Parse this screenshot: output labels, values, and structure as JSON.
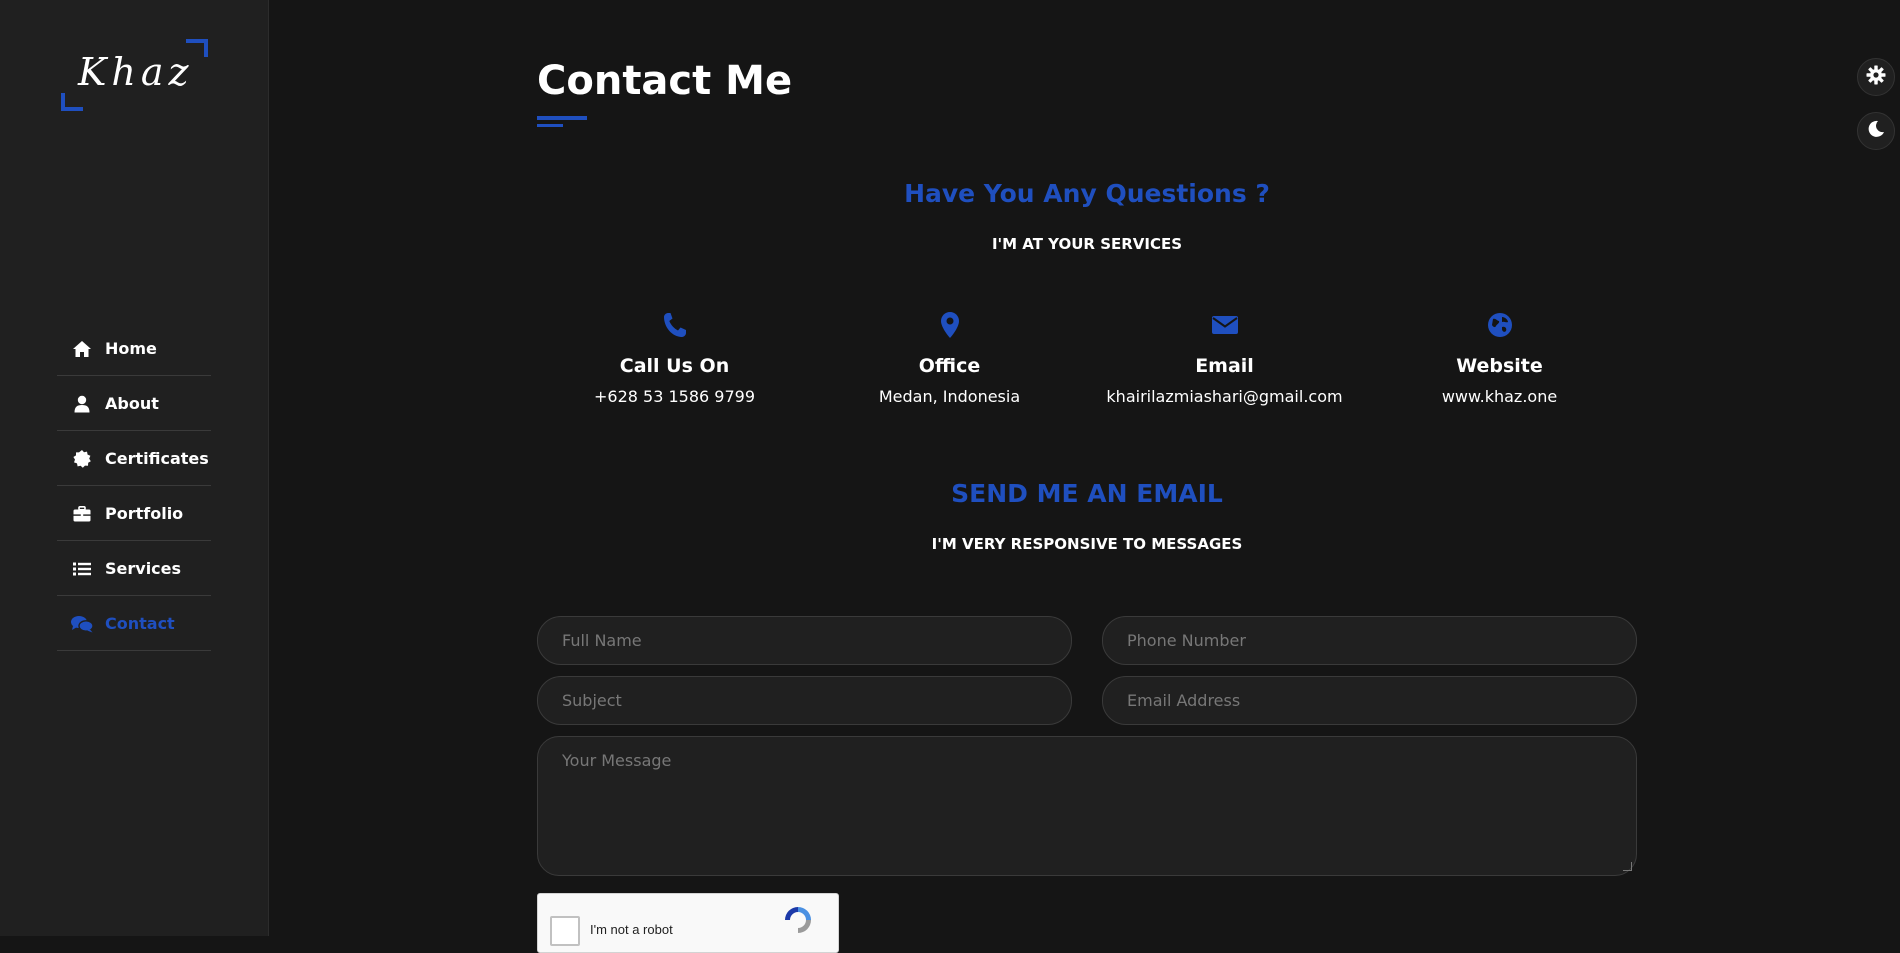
{
  "brand": {
    "logo_text": "Khaz"
  },
  "sidebar": {
    "items": [
      {
        "label": "Home",
        "icon": "home-icon"
      },
      {
        "label": "About",
        "icon": "user-icon"
      },
      {
        "label": "Certificates",
        "icon": "certificate-icon"
      },
      {
        "label": "Portfolio",
        "icon": "briefcase-icon"
      },
      {
        "label": "Services",
        "icon": "list-icon"
      },
      {
        "label": "Contact",
        "icon": "comments-icon",
        "active": true
      }
    ]
  },
  "main": {
    "page_title": "Contact Me",
    "questions_heading": "Have You Any Questions ?",
    "questions_sub": "I'M AT YOUR SERVICES",
    "info": [
      {
        "title": "Call Us On",
        "value": "+628 53 1586 9799",
        "icon": "phone-icon"
      },
      {
        "title": "Office",
        "value": "Medan, Indonesia",
        "icon": "map-marker-icon"
      },
      {
        "title": "Email",
        "value": "khairilazmiashari@gmail.com",
        "icon": "envelope-icon"
      },
      {
        "title": "Website",
        "value": "www.khaz.one",
        "icon": "globe-icon"
      }
    ],
    "email_heading": "SEND ME AN EMAIL",
    "email_sub": "I'M VERY RESPONSIVE TO MESSAGES",
    "form": {
      "full_name_placeholder": "Full Name",
      "phone_placeholder": "Phone Number",
      "subject_placeholder": "Subject",
      "email_placeholder": "Email Address",
      "message_placeholder": "Your Message"
    },
    "captcha_label": "I'm not a robot"
  },
  "theme": {
    "accent": "#1f4fbf",
    "background": "#151515",
    "sidebar": "#202020"
  },
  "tools": {
    "settings_icon": "gear-icon",
    "theme_icon": "moon-icon"
  }
}
